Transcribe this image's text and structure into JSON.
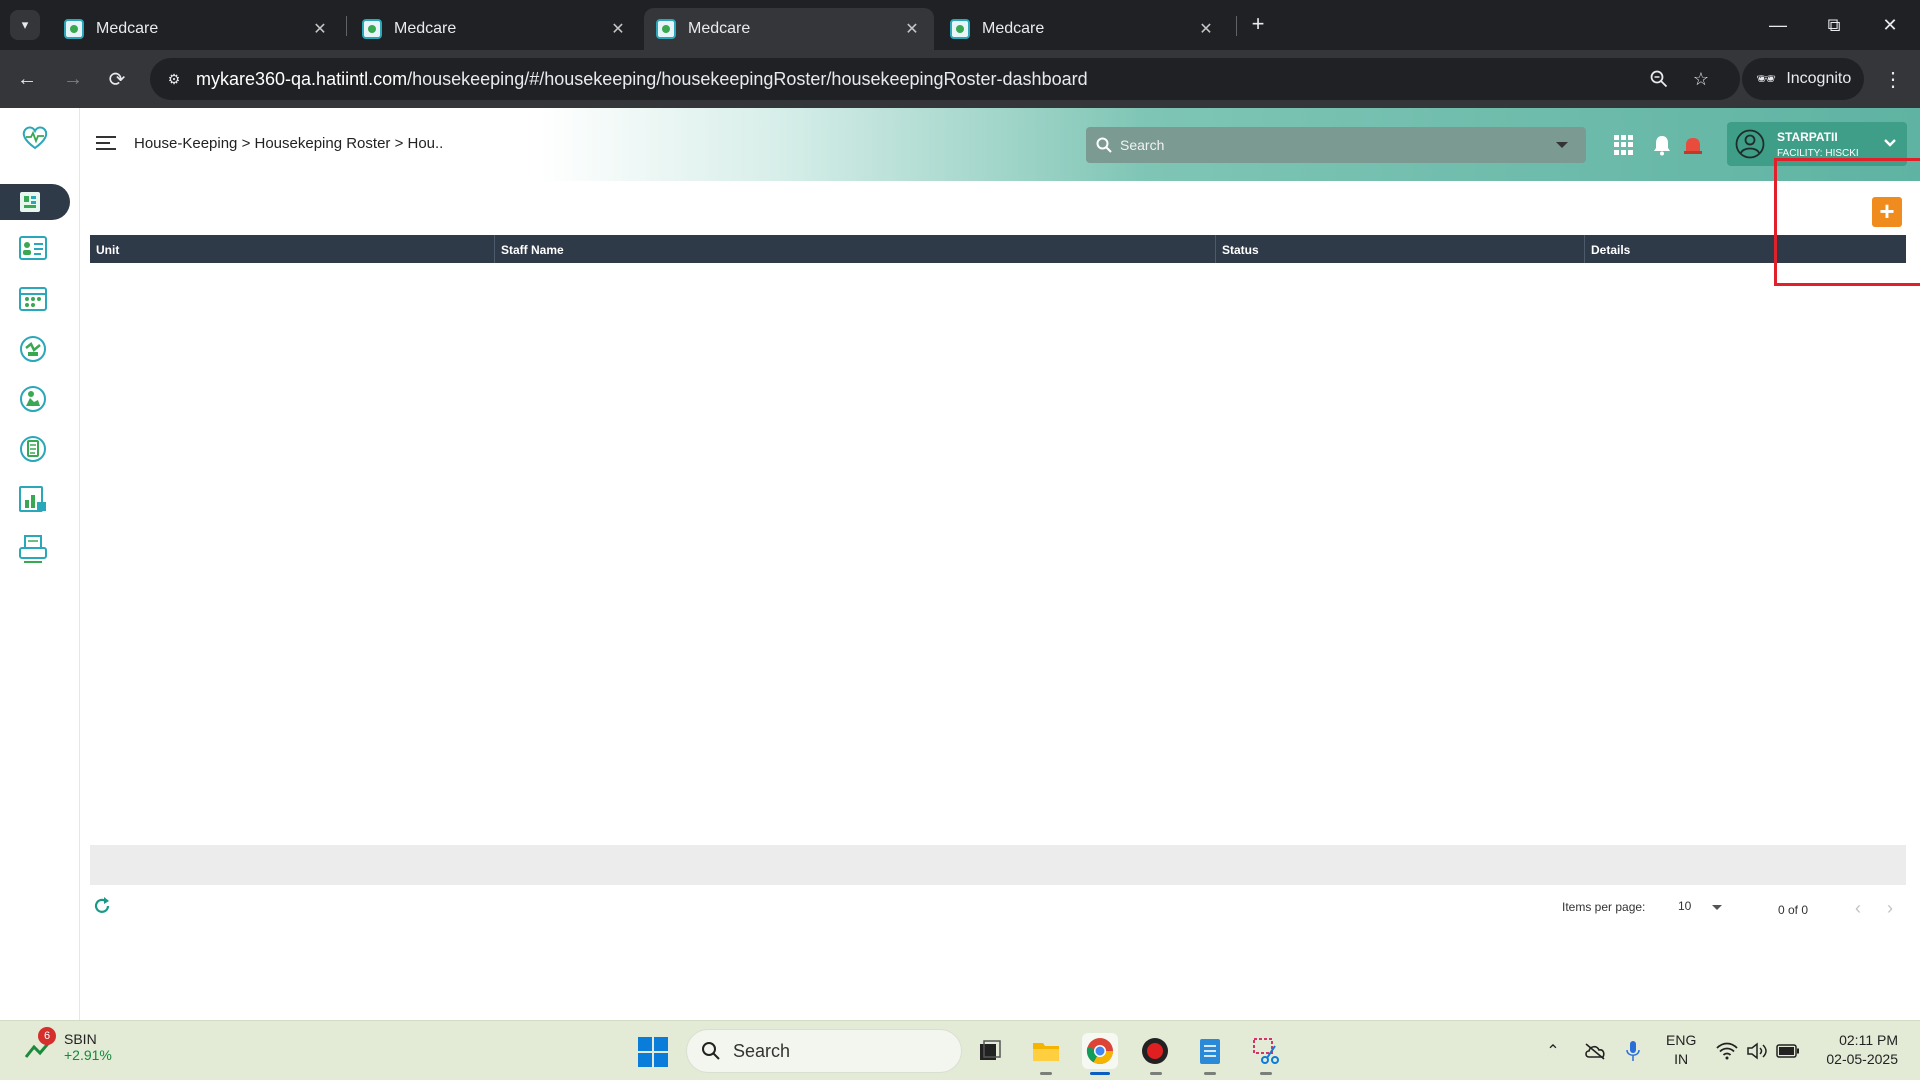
{
  "browser": {
    "tabs": [
      {
        "label": "Medcare",
        "active": false
      },
      {
        "label": "Medcare",
        "active": false
      },
      {
        "label": "Medcare",
        "active": true
      },
      {
        "label": "Medcare",
        "active": false
      }
    ],
    "url_host": "mykare360-qa.hatiintl.com",
    "url_path": "/housekeeping/#/housekeeping/housekeepingRoster/housekeepingRoster-dashboard",
    "incognito_label": "Incognito"
  },
  "app": {
    "breadcrumb": "House-Keeping > Housekeping Roster > Hou..",
    "search": {
      "placeholder": "Search"
    },
    "user": {
      "name": "STARPATII",
      "facility": "FACILITY: HISCKI"
    },
    "add_button_label": "+",
    "accent_colors": {
      "header": "#5fb3a2",
      "table_header": "#2f3a48",
      "add_button": "#f08c1e",
      "highlight": "#e0202a"
    },
    "table": {
      "columns": [
        "Unit",
        "Staff Name",
        "Status",
        "Details"
      ],
      "rows": []
    },
    "paginator": {
      "items_per_page_label": "Items per page:",
      "items_per_page_value": "10",
      "range_label": "0 of 0"
    }
  },
  "taskbar": {
    "stock": {
      "badge": "6",
      "name": "SBIN",
      "change": "+2.91%"
    },
    "search_placeholder": "Search",
    "language": {
      "line1": "ENG",
      "line2": "IN"
    },
    "time": "02:11 PM",
    "date": "02-05-2025"
  }
}
